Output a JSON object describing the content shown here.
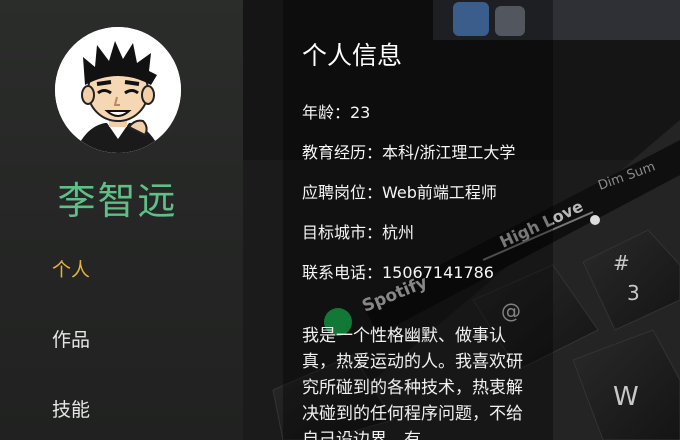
{
  "profile": {
    "name": "李智远"
  },
  "nav": {
    "items": [
      {
        "label": "个人",
        "active": true
      },
      {
        "label": "作品",
        "active": false
      },
      {
        "label": "技能",
        "active": false
      }
    ],
    "active_color": "#e8b33a"
  },
  "info": {
    "title": "个人信息",
    "age": "年龄：23",
    "education": "教育经历：本科/浙江理工大学",
    "position": "应聘岗位：Web前端工程师",
    "city": "目标城市：杭州",
    "phone": "联系电话：15067141786",
    "bio": "我是一个性格幽默、做事认真，热爱运动的人。我喜欢研究所碰到的各种技术，热衷解决碰到的任何程序问题，不给自己设边界，有"
  },
  "background_keyboard": {
    "touchbar_labels": [
      "Dim Sum",
      "High Love",
      "Spotify"
    ],
    "key_labels": [
      "#",
      "3",
      "@",
      "W"
    ]
  },
  "colors": {
    "name": "#5fbf86",
    "sidebar": "#262726"
  }
}
